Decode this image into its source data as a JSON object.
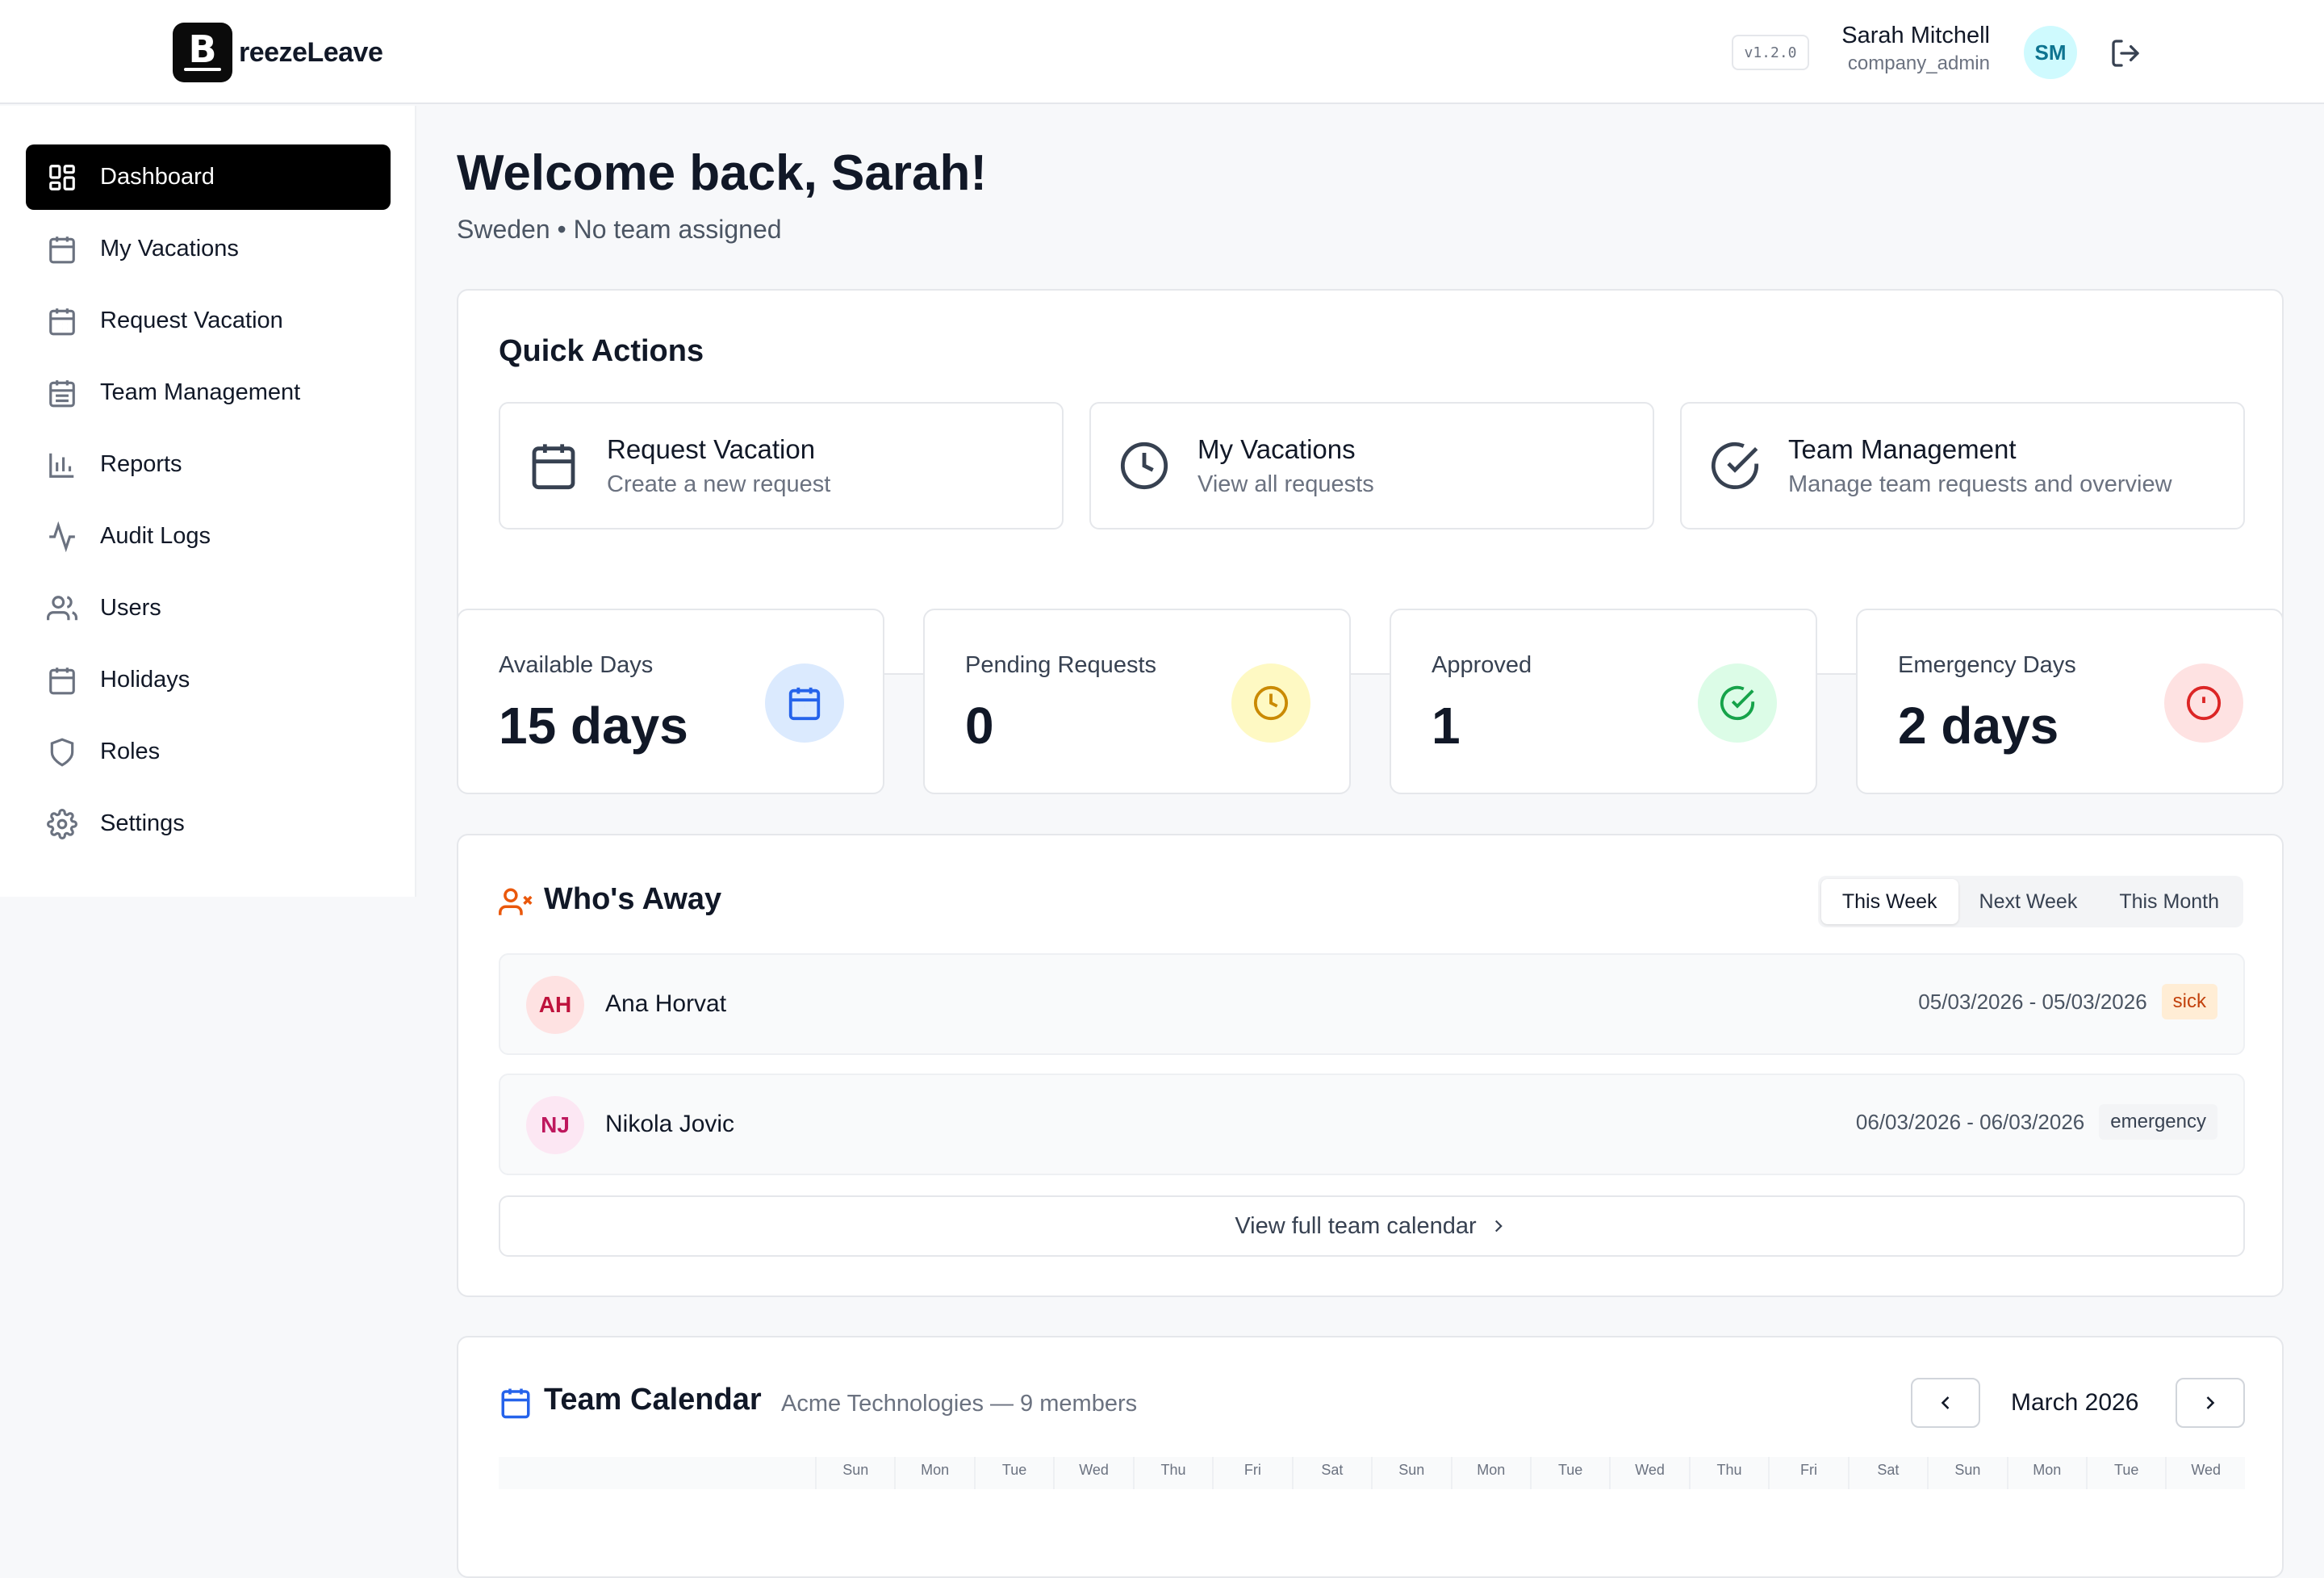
{
  "header": {
    "logo_letter": "B",
    "app_name": "reezeLeave",
    "version": "v1.2.0",
    "user_name": "Sarah Mitchell",
    "user_role": "company_admin",
    "user_initials": "SM"
  },
  "sidebar": {
    "items": [
      {
        "label": "Dashboard",
        "icon": "dashboard-icon",
        "active": true
      },
      {
        "label": "My Vacations",
        "icon": "calendar-icon"
      },
      {
        "label": "Request Vacation",
        "icon": "calendar-days-icon"
      },
      {
        "label": "Team Management",
        "icon": "calendar-days-icon"
      },
      {
        "label": "Reports",
        "icon": "bar-chart-icon"
      },
      {
        "label": "Audit Logs",
        "icon": "activity-icon"
      },
      {
        "label": "Users",
        "icon": "users-icon"
      },
      {
        "label": "Holidays",
        "icon": "calendar-icon"
      },
      {
        "label": "Roles",
        "icon": "shield-icon"
      },
      {
        "label": "Settings",
        "icon": "gear-icon"
      }
    ]
  },
  "main": {
    "welcome": "Welcome back, Sarah!",
    "subtitle": "Sweden • No team assigned",
    "quick_actions": {
      "title": "Quick Actions",
      "items": [
        {
          "title": "Request Vacation",
          "desc": "Create a new request",
          "icon": "calendar-icon"
        },
        {
          "title": "My Vacations",
          "desc": "View all requests",
          "icon": "clock-icon"
        },
        {
          "title": "Team Management",
          "desc": "Manage team requests and overview",
          "icon": "check-circle-icon"
        }
      ]
    },
    "stats": [
      {
        "label": "Available Days",
        "value": "15 days",
        "icon": "calendar-icon",
        "color": "#2563eb",
        "bg": "#dbeafe"
      },
      {
        "label": "Pending Requests",
        "value": "0",
        "icon": "clock-icon",
        "color": "#ca8a04",
        "bg": "#fef9c3"
      },
      {
        "label": "Approved",
        "value": "1",
        "icon": "check-circle-icon",
        "color": "#16a34a",
        "bg": "#dcfce7"
      },
      {
        "label": "Emergency Days",
        "value": "2 days",
        "icon": "alert-circle-icon",
        "color": "#dc2626",
        "bg": "#fee2e2"
      }
    ],
    "whos_away": {
      "title": "Who's Away",
      "tabs": [
        "This Week",
        "Next Week",
        "This Month"
      ],
      "active_tab": "This Week",
      "people": [
        {
          "initials": "AH",
          "name": "Ana Horvat",
          "dates": "05/03/2026 - 05/03/2026",
          "type": "sick"
        },
        {
          "initials": "NJ",
          "name": "Nikola Jovic",
          "dates": "06/03/2026 - 06/03/2026",
          "type": "emergency"
        }
      ],
      "view_full": "View full team calendar"
    },
    "team_calendar": {
      "title": "Team Calendar",
      "org": "Acme Technologies — 9 members",
      "month": "March 2026",
      "day_headers": [
        "Sun",
        "Mon",
        "Tue",
        "Wed",
        "Thu",
        "Fri",
        "Sat",
        "Sun",
        "Mon",
        "Tue",
        "Wed",
        "Thu",
        "Fri",
        "Sat",
        "Sun",
        "Mon",
        "Tue",
        "Wed"
      ]
    }
  }
}
